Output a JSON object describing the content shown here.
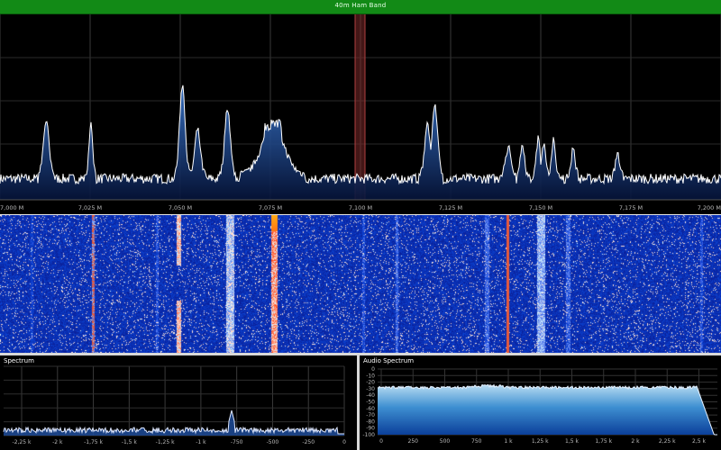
{
  "band_bar": {
    "label": "40m Ham Band",
    "color": "#128a16"
  },
  "main_spectrum": {
    "freq_axis": [
      "7,000 M",
      "7,025 M",
      "7,050 M",
      "7,075 M",
      "7,100 M",
      "7,125 M",
      "7,150 M",
      "7,175 M",
      "7,200 M"
    ],
    "tuned_label": "7,100 M",
    "signal_peaks_mhz": [
      7.0128,
      7.0252,
      7.0506,
      7.0548,
      7.0631,
      7.0757,
      7.1186,
      7.1206,
      7.141,
      7.1449,
      7.1493,
      7.1508,
      7.1535,
      7.159,
      7.1713
    ],
    "line_color": "#ffffff",
    "fill_color": "#123e8c"
  },
  "waterfall": {
    "palette": [
      "#0b1fa0",
      "#3b6cff",
      "#ffffff",
      "#ffb020",
      "#ff4000"
    ]
  },
  "if_spectrum": {
    "title": "Spectrum",
    "freq_axis": [
      "-2,25 k",
      "-2 k",
      "-1,75 k",
      "-1,5 k",
      "-1,25 k",
      "-1 k",
      "-750",
      "-500",
      "-250",
      "0"
    ]
  },
  "audio_spectrum": {
    "title": "Audio Spectrum",
    "db_axis": [
      "0",
      "-10",
      "-20",
      "-30",
      "-40",
      "-50",
      "-60",
      "-70",
      "-80",
      "-90",
      "-100"
    ],
    "freq_axis": [
      "0",
      "250",
      "500",
      "750",
      "1 k",
      "1,25 k",
      "1,5 k",
      "1,75 k",
      "2 k",
      "2,25 k",
      "2,5 k"
    ]
  }
}
